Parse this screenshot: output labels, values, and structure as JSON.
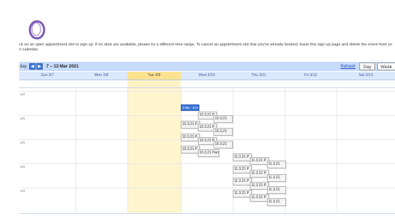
{
  "colors": {
    "logo": "#7b5bb8",
    "toolbar": "#c7dbfb",
    "nav_button": "#3f7ad8",
    "today_header": "#fde28f",
    "today_column": "#fff5cf",
    "selected_event": "#3b74d8"
  },
  "logo": {
    "icon": "ring-logo"
  },
  "instructions": {
    "line1": "ck on an open appointment slot to sign up. If no slots are available, please try a different time range. To cancel an appointment slot that you've already booked, leave this sign-up page and delete the event from yo",
    "line2": "n calendar."
  },
  "toolbar": {
    "today_label": "day",
    "prev_label": "◀",
    "next_label": "▶",
    "range_label": "7 – 13 Mar 2021",
    "refresh_label": "Refresh",
    "day_label": "Day",
    "week_label": "Week"
  },
  "days": [
    {
      "label": "Sun 3/7"
    },
    {
      "label": "Mon 3/8"
    },
    {
      "label": "Tue 3/9",
      "today": true
    },
    {
      "label": "Wed 3/10"
    },
    {
      "label": "Thu 3/11"
    },
    {
      "label": "Fri 3/12"
    },
    {
      "label": "Sat 3/13"
    }
  ],
  "time_labels": [
    "pm",
    "pm",
    "pm",
    "pm",
    "pm"
  ],
  "events": [
    {
      "label": "3:45p - 10.3.21 Pa",
      "selected": true
    },
    {
      "label": "10.3.21 P"
    },
    {
      "label": "10.3.21"
    },
    {
      "label": "10.3.21 P"
    },
    {
      "label": "10.3.21 P"
    },
    {
      "label": "10.3.21"
    },
    {
      "label": "10.3.21 P"
    },
    {
      "label": "10.3.21 P"
    },
    {
      "label": "10.3.21"
    },
    {
      "label": "10.3.21 P"
    },
    {
      "label": "10.3.21 Parents'"
    },
    {
      "label": "11.3.21 P"
    },
    {
      "label": "11.3.21 P"
    },
    {
      "label": "11.3.21"
    },
    {
      "label": "11.3.21 P"
    },
    {
      "label": "11.3.21 P"
    },
    {
      "label": "11.3.21"
    },
    {
      "label": "11.3.21 P"
    },
    {
      "label": "11.3.21 P"
    },
    {
      "label": "11.3.21"
    },
    {
      "label": "11.3.21 P"
    },
    {
      "label": "11.3.21 P"
    },
    {
      "label": "11.3.21"
    }
  ]
}
